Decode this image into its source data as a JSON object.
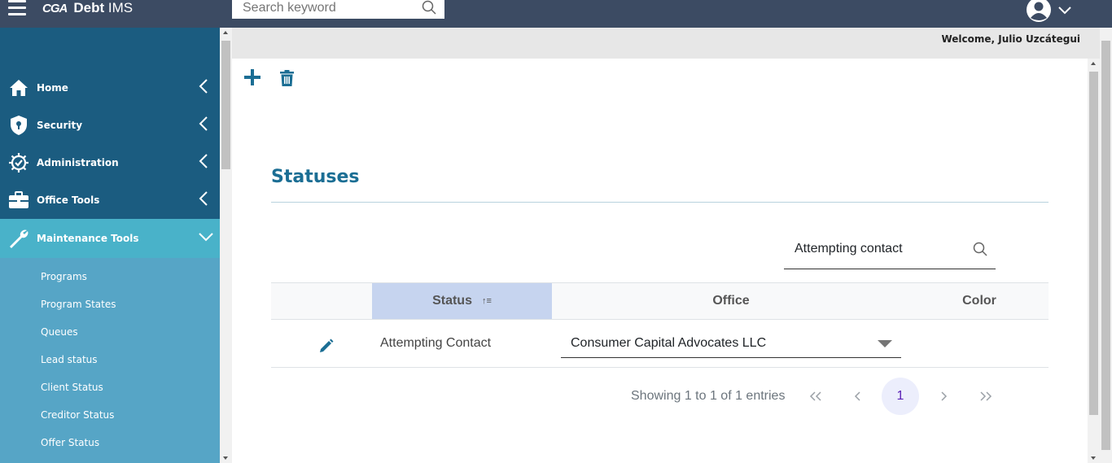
{
  "app": {
    "logo_mark": "CGA",
    "title_bold": "Debt",
    "title_rest": " IMS"
  },
  "header": {
    "search_placeholder": "Search keyword",
    "user_icon": "user-circle-icon"
  },
  "sidebar": {
    "items": [
      {
        "label": "Home",
        "icon": "home-icon"
      },
      {
        "label": "Security",
        "icon": "shield-icon"
      },
      {
        "label": "Administration",
        "icon": "gear-icon"
      },
      {
        "label": "Office Tools",
        "icon": "briefcase-icon"
      },
      {
        "label": "Maintenance Tools",
        "icon": "wrench-icon",
        "expanded": true
      }
    ],
    "submenu": [
      "Programs",
      "Program States",
      "Queues",
      "Lead status",
      "Client Status",
      "Creditor Status",
      "Offer Status"
    ]
  },
  "main": {
    "welcome": "Welcome, Julio Uzcátegui",
    "page_title": "Statuses",
    "table_search_value": "Attempting contact",
    "columns": [
      "Status",
      "Office",
      "Color"
    ],
    "sort_indicator": "↑≡",
    "rows": [
      {
        "status": "Attempting Contact",
        "office": "Consumer Capital Advocates LLC",
        "color": ""
      }
    ],
    "pagination": {
      "info": "Showing 1 to 1 of 1 entries",
      "first": "«",
      "prev": "‹",
      "current": "1",
      "next": "›",
      "last": "»"
    }
  },
  "colors": {
    "topbar": "#3c4b63",
    "sidebar": "#1b5c80",
    "sidebar_active": "#49b2c9",
    "submenu": "#56a5c6",
    "accent": "#1b6e94",
    "sorted_header": "#c6d4ef"
  }
}
